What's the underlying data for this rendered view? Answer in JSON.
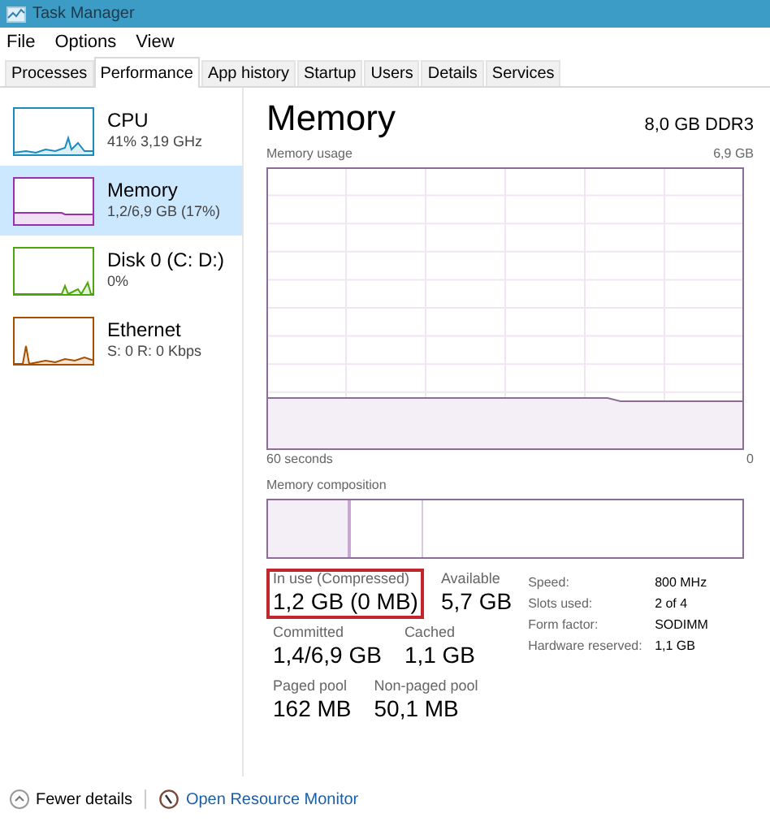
{
  "window": {
    "title": "Task Manager"
  },
  "menu": [
    "File",
    "Options",
    "View"
  ],
  "tabs": [
    {
      "label": "Processes",
      "selected": false
    },
    {
      "label": "Performance",
      "selected": true
    },
    {
      "label": "App history",
      "selected": false
    },
    {
      "label": "Startup",
      "selected": false
    },
    {
      "label": "Users",
      "selected": false
    },
    {
      "label": "Details",
      "selected": false
    },
    {
      "label": "Services",
      "selected": false
    }
  ],
  "sidebar": {
    "items": [
      {
        "name": "CPU",
        "detail": "41% 3,19 GHz",
        "color": "#1b8bbd",
        "selected": false
      },
      {
        "name": "Memory",
        "detail": "1,2/6,9 GB (17%)",
        "color": "#9b2fae",
        "selected": true
      },
      {
        "name": "Disk 0 (C: D:)",
        "detail": "0%",
        "color": "#4da60c",
        "selected": false
      },
      {
        "name": "Ethernet",
        "detail": "S: 0 R: 0 Kbps",
        "color": "#a74f01",
        "selected": false
      }
    ]
  },
  "main": {
    "title": "Memory",
    "subtitle": "8,0 GB DDR3",
    "usage_label": "Memory usage",
    "usage_max": "6,9 GB",
    "time_start": "60 seconds",
    "time_end": "0",
    "composition_label": "Memory composition",
    "stats": [
      [
        {
          "label": "In use (Compressed)",
          "value": "1,2 GB (0 MB)",
          "highlighted": true
        },
        {
          "label": "Available",
          "value": "5,7 GB",
          "highlighted": false
        }
      ],
      [
        {
          "label": "Committed",
          "value": "1,4/6,9 GB",
          "highlighted": false
        },
        {
          "label": "Cached",
          "value": "1,1 GB",
          "highlighted": false
        }
      ],
      [
        {
          "label": "Paged pool",
          "value": "162 MB",
          "highlighted": false
        },
        {
          "label": "Non-paged pool",
          "value": "50,1 MB",
          "highlighted": false
        }
      ]
    ],
    "details": [
      {
        "key": "Speed:",
        "value": "800 MHz"
      },
      {
        "key": "Slots used:",
        "value": "2 of 4"
      },
      {
        "key": "Form factor:",
        "value": "SODIMM"
      },
      {
        "key": "Hardware reserved:",
        "value": "1,1 GB"
      }
    ]
  },
  "footer": {
    "fewer_details": "Fewer details",
    "resource_monitor": "Open Resource Monitor"
  }
}
